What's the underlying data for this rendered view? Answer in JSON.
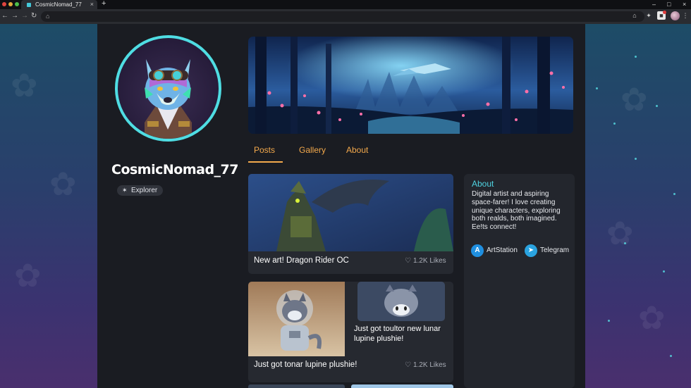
{
  "browser": {
    "tab_title": "CosmicNomad_77",
    "close_glyph": "×",
    "new_tab_glyph": "+",
    "window_controls": [
      "–",
      "□",
      "×"
    ]
  },
  "profile": {
    "username": "CosmicNomad_77",
    "badge": "Explorer"
  },
  "tabs": [
    "Posts",
    "Gallery",
    "About"
  ],
  "posts": [
    {
      "title": "New art! Dragon Rider OC",
      "likes": "1.2K Likes"
    },
    {
      "title": "Just got tonar lupine plushie!",
      "likes": "1.2K Likes",
      "overlay": "Just got toultor new lunar lupine plushie!"
    }
  ],
  "about": {
    "title": "About",
    "text": "Digital artist and aspiring space-farer! I love creating unique characters, exploring both realds, both imagined. Ee!ts connect!",
    "links": [
      {
        "label": "ArtStation",
        "icon": "artstation-icon",
        "color": "#1f8fe0"
      },
      {
        "label": "Telegram",
        "icon": "telegram-icon",
        "color": "#2aa3e0"
      }
    ]
  },
  "colors": {
    "accent_orange": "#f3a94c",
    "accent_cyan": "#4fd2e0",
    "panel": "#1a1c22"
  }
}
